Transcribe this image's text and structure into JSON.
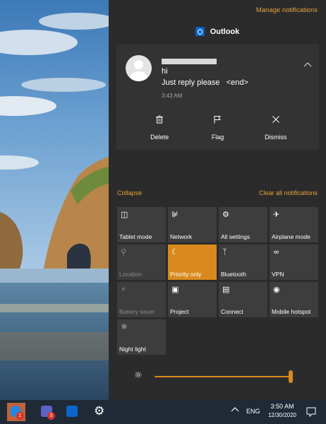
{
  "action_center": {
    "manage_label": "Manage notifications",
    "app_name": "Outlook",
    "notification": {
      "subject": "hi",
      "body": "Just reply please   <end>",
      "time": "3:43 AM",
      "actions": [
        {
          "label": "Delete",
          "icon": "delete-icon"
        },
        {
          "label": "Flag",
          "icon": "flag-icon"
        },
        {
          "label": "Dismiss",
          "icon": "dismiss-icon"
        }
      ]
    },
    "collapse_label": "Collapse",
    "clear_label": "Clear all notifications",
    "quick_actions": [
      {
        "label": "Tablet mode",
        "icon": "tablet-mode-icon",
        "state": "off"
      },
      {
        "label": "Network",
        "icon": "network-icon",
        "state": "off"
      },
      {
        "label": "All settings",
        "icon": "gear-icon",
        "state": "off"
      },
      {
        "label": "Airplane mode",
        "icon": "airplane-icon",
        "state": "off"
      },
      {
        "label": "Location",
        "icon": "location-icon",
        "state": "disabled"
      },
      {
        "label": "Priority only",
        "icon": "moon-icon",
        "state": "on"
      },
      {
        "label": "Bluetooth",
        "icon": "bluetooth-icon",
        "state": "off"
      },
      {
        "label": "VPN",
        "icon": "vpn-icon",
        "state": "off"
      },
      {
        "label": "Battery saver",
        "icon": "battery-saver-icon",
        "state": "disabled"
      },
      {
        "label": "Project",
        "icon": "project-icon",
        "state": "off"
      },
      {
        "label": "Connect",
        "icon": "connect-icon",
        "state": "off"
      },
      {
        "label": "Mobile hotspot",
        "icon": "mobile-hotspot-icon",
        "state": "off"
      },
      {
        "label": "Night light",
        "icon": "night-light-icon",
        "state": "off"
      }
    ],
    "brightness_level": 1.0
  },
  "taskbar": {
    "apps": [
      {
        "name": "skype-app",
        "badge": "1",
        "active": true
      },
      {
        "name": "teams-app",
        "badge": "3",
        "active": false
      },
      {
        "name": "outlook-app",
        "badge": "",
        "active": false
      },
      {
        "name": "settings-app",
        "badge": "",
        "active": false
      }
    ],
    "language": "ENG",
    "time": "3:50 AM",
    "date": "12/30/2020"
  },
  "colors": {
    "accent": "#d98a1e",
    "link": "#e6a23c",
    "panel": "#2b2b2b",
    "tile": "#3d3d3d",
    "taskbar": "#1f2a36"
  }
}
